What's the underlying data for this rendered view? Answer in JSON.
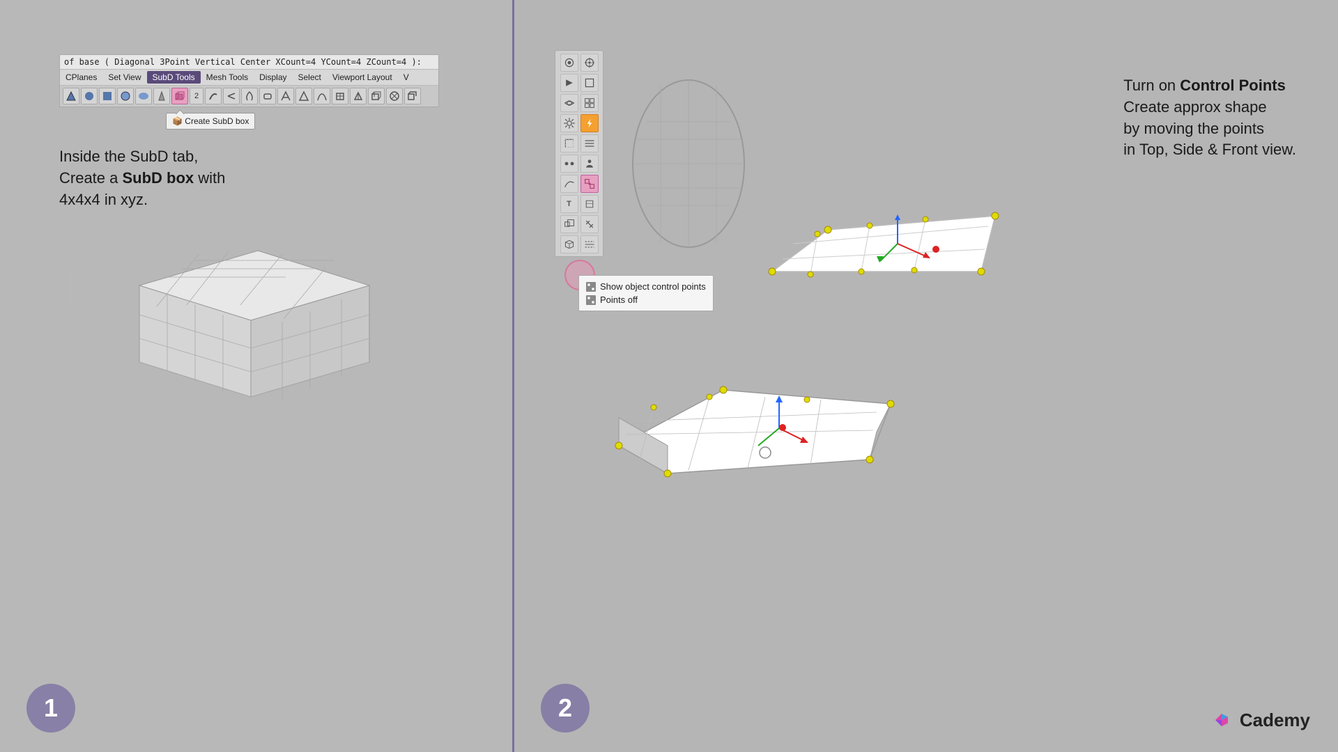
{
  "left": {
    "command_bar": "of base ( Diagonal  3Point  Vertical  Center  XCount=4  YCount=4  ZCount=4 ):",
    "menu_items": [
      "CPlanes",
      "Set View",
      "SubD Tools",
      "Mesh Tools",
      "Display",
      "Select",
      "Viewport Layout",
      "V"
    ],
    "active_menu": "SubD Tools",
    "tooltip": "Create SubD box",
    "instruction_line1": "Inside the SubD tab,",
    "instruction_line2_prefix": "Create a ",
    "instruction_line2_bold": "SubD box",
    "instruction_line2_suffix": " with",
    "instruction_line3": "4x4x4 in xyz.",
    "circle_number": "1"
  },
  "right": {
    "instruction_line1": "Turn on ",
    "instruction_bold": "Control Points",
    "instruction_line2": "Create approx shape",
    "instruction_line3": "by moving the points",
    "instruction_line4": "in Top, Side & Front view.",
    "context_menu": {
      "item1": "Show object control points",
      "item2": "Points off"
    },
    "circle_number": "2",
    "cademy_label": "Cademy"
  }
}
